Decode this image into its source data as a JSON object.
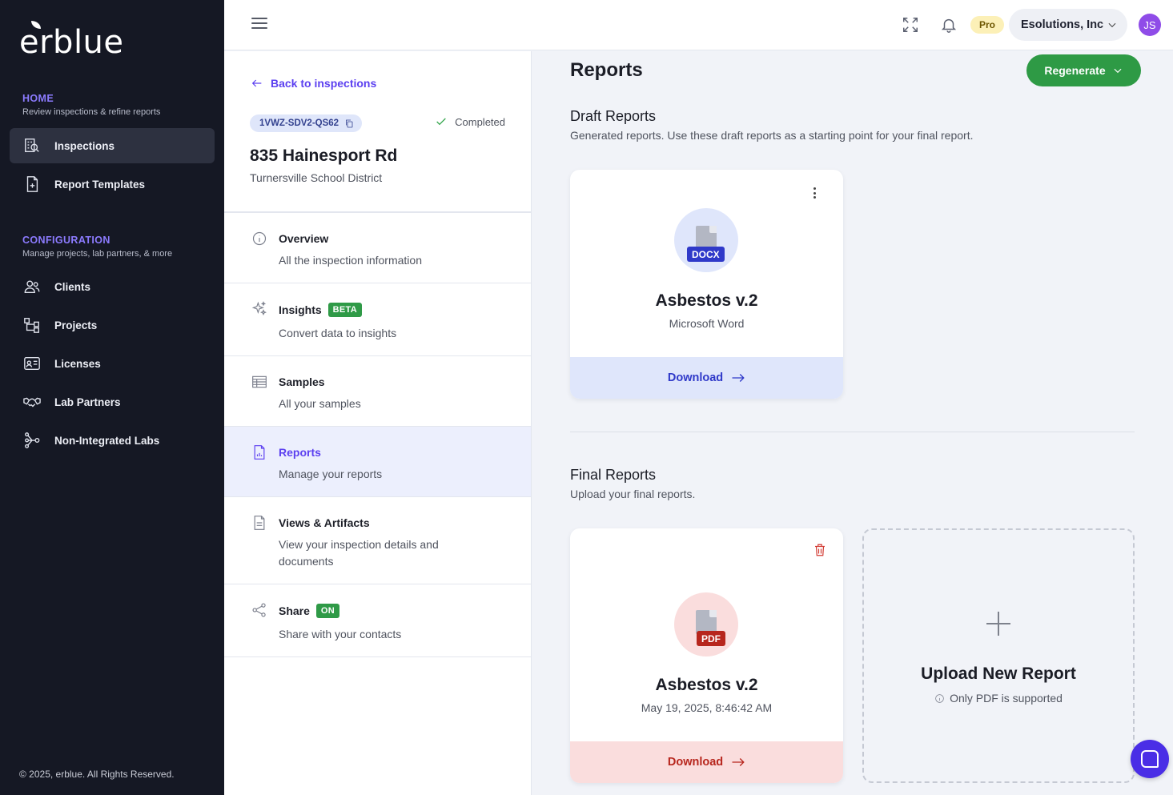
{
  "brand": {
    "logo_text": "erblue"
  },
  "sidebar": {
    "home_title": "HOME",
    "home_sub": "Review inspections & refine reports",
    "config_title": "CONFIGURATION",
    "config_sub": "Manage projects, lab partners, & more",
    "items": [
      {
        "label": "Inspections",
        "icon": "inspections-icon",
        "active": true
      },
      {
        "label": "Report Templates",
        "icon": "report-template-icon"
      },
      {
        "label": "Clients",
        "icon": "clients-icon"
      },
      {
        "label": "Projects",
        "icon": "projects-icon"
      },
      {
        "label": "Licenses",
        "icon": "license-icon"
      },
      {
        "label": "Lab Partners",
        "icon": "handshake-icon"
      },
      {
        "label": "Non-Integrated Labs",
        "icon": "network-icon"
      }
    ],
    "copyright": "© 2025, erblue. All Rights Reserved."
  },
  "topbar": {
    "pro_label": "Pro",
    "org_name": "Esolutions, Inc",
    "avatar_initials": "JS"
  },
  "inspection": {
    "back_label": "Back to inspections",
    "code": "1VWZ-SDV2-QS62",
    "status": "Completed",
    "address": "835 Hainesport Rd",
    "district": "Turnersville School District"
  },
  "menu": [
    {
      "title": "Overview",
      "sub": "All the inspection information",
      "icon": "info-icon"
    },
    {
      "title": "Insights",
      "badge": "BETA",
      "sub": "Convert data to insights",
      "icon": "sparkle-icon"
    },
    {
      "title": "Samples",
      "sub": "All your samples",
      "icon": "table-icon"
    },
    {
      "title": "Reports",
      "sub": "Manage your reports",
      "icon": "report-icon",
      "active": true
    },
    {
      "title": "Views & Artifacts",
      "sub": "View your inspection details and documents",
      "icon": "document-icon"
    },
    {
      "title": "Share",
      "badge": "ON",
      "sub": "Share with your contacts",
      "icon": "share-icon"
    }
  ],
  "main": {
    "title": "Reports",
    "regenerate_label": "Regenerate",
    "draft": {
      "heading": "Draft Reports",
      "description": "Generated reports. Use these draft reports as a starting point for your final report.",
      "card": {
        "file_type": "DOCX",
        "title": "Asbestos v.2",
        "subtitle": "Microsoft Word",
        "action": "Download",
        "accent": "#2f39c9",
        "tint": "#dfe6fb"
      }
    },
    "final": {
      "heading": "Final Reports",
      "description": "Upload your final reports.",
      "card": {
        "file_type": "PDF",
        "title": "Asbestos v.2",
        "subtitle": "May 19, 2025, 8:46:42 AM",
        "action": "Download",
        "accent": "#b7261d",
        "tint": "#fadddd"
      },
      "upload": {
        "title": "Upload New Report",
        "note": "Only PDF is supported"
      }
    }
  }
}
